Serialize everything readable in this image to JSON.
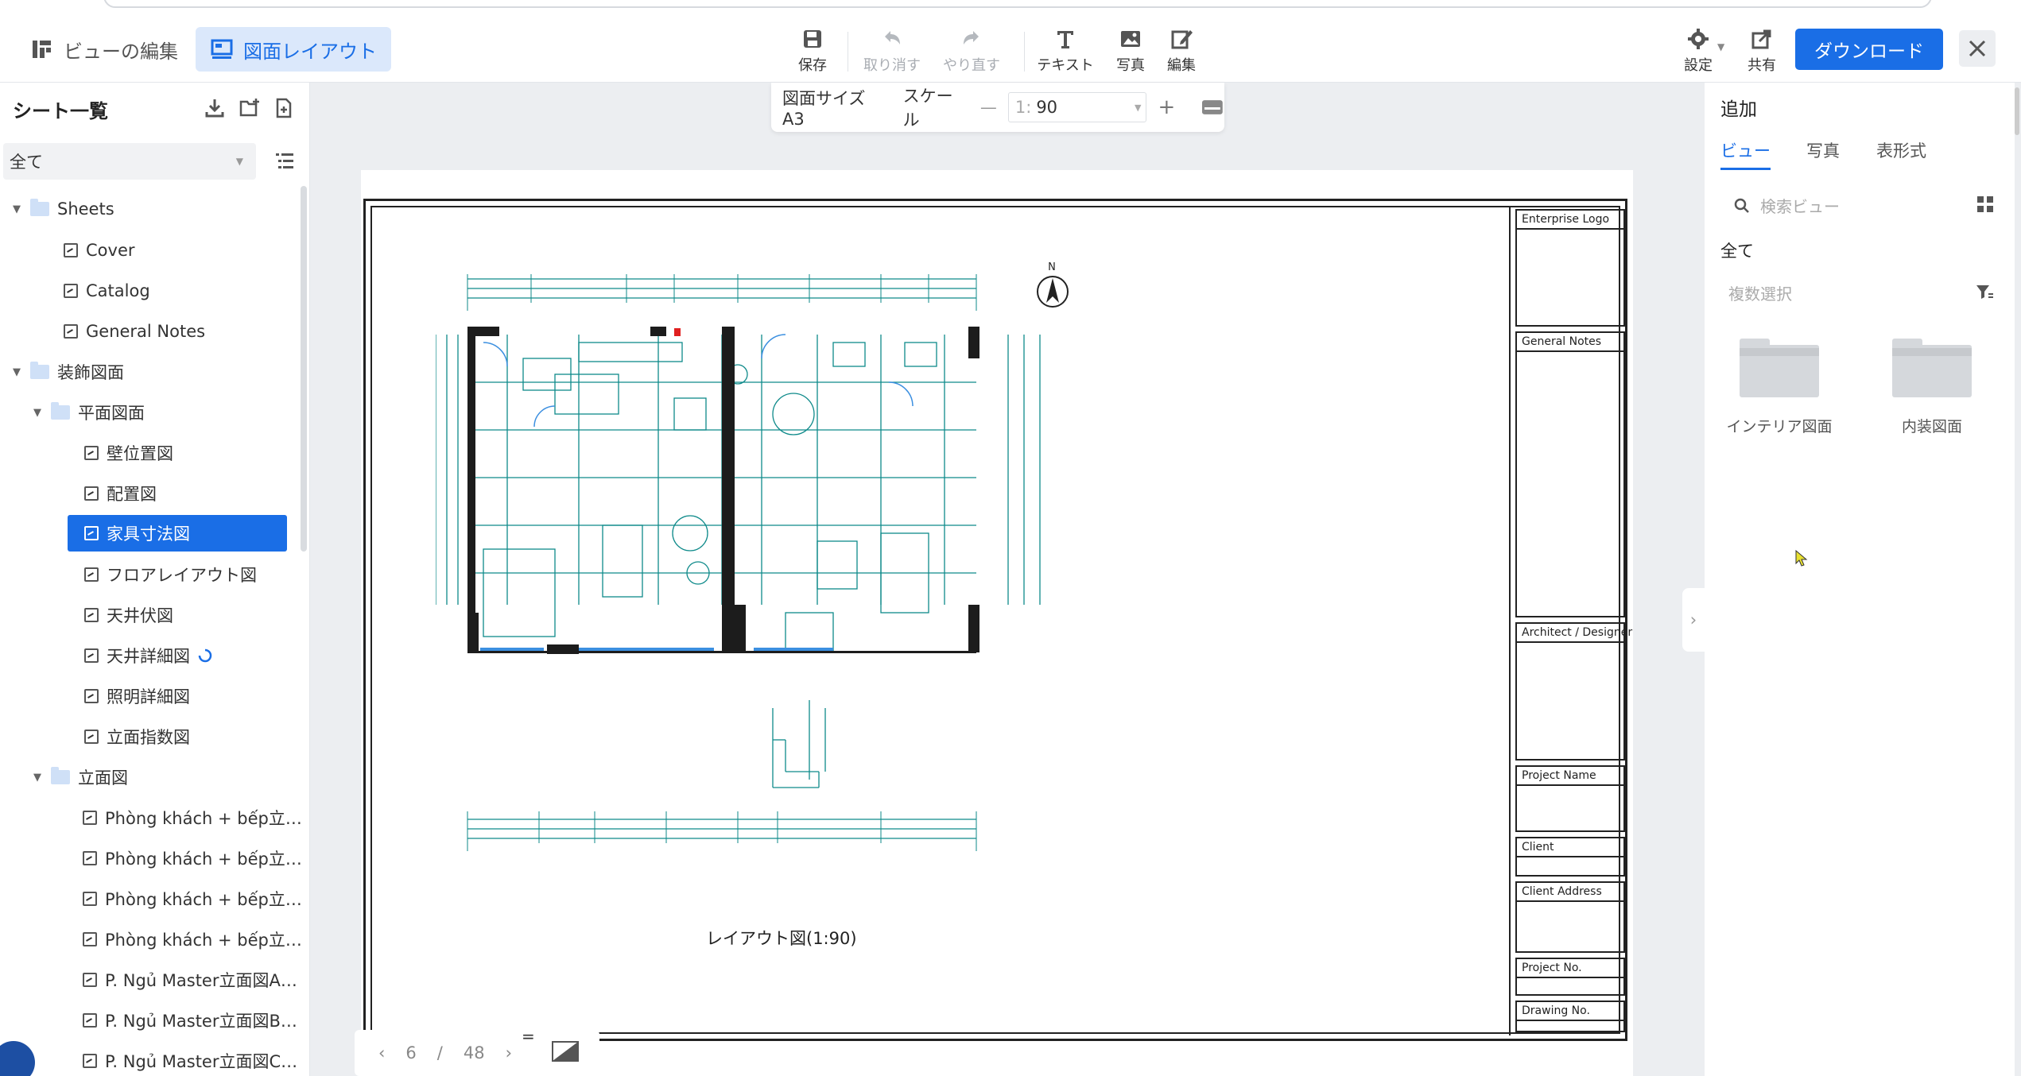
{
  "topbar": {
    "edit_view_label": "ビューの編集",
    "layout_label": "図面レイアウト",
    "tools": [
      {
        "label": "保存",
        "icon": "save-icon",
        "enabled": true
      },
      {
        "label": "取り消す",
        "icon": "undo-icon",
        "enabled": false
      },
      {
        "label": "やり直す",
        "icon": "redo-icon",
        "enabled": false
      },
      {
        "label": "テキスト",
        "icon": "text-icon",
        "enabled": true
      },
      {
        "label": "写真",
        "icon": "image-icon",
        "enabled": true
      },
      {
        "label": "編集",
        "icon": "edit-icon",
        "enabled": true
      }
    ],
    "settings_label": "設定",
    "share_label": "共有",
    "download_label": "ダウンロード",
    "accent_color": "#1a6ee6"
  },
  "sidebar": {
    "title": "シート一覧",
    "filter_value": "全て",
    "tree": [
      {
        "label": "Sheets",
        "type": "folder",
        "expanded": true
      },
      {
        "label": "Cover",
        "type": "sheet"
      },
      {
        "label": "Catalog",
        "type": "sheet"
      },
      {
        "label": "General Notes",
        "type": "sheet"
      },
      {
        "label": "装飾図面",
        "type": "folder",
        "expanded": true
      },
      {
        "label": "平面図面",
        "type": "folder",
        "expanded": true
      },
      {
        "label": "壁位置図",
        "type": "sheet"
      },
      {
        "label": "配置図",
        "type": "sheet"
      },
      {
        "label": "家具寸法図",
        "type": "sheet",
        "selected": true
      },
      {
        "label": "フロアレイアウト図",
        "type": "sheet"
      },
      {
        "label": "天井伏図",
        "type": "sheet"
      },
      {
        "label": "天井詳細図",
        "type": "sheet",
        "loading": true
      },
      {
        "label": "照明詳細図",
        "type": "sheet"
      },
      {
        "label": "立面指数図",
        "type": "sheet"
      },
      {
        "label": "立面図",
        "type": "folder",
        "expanded": true
      },
      {
        "label": "Phòng khách + bếp立…",
        "type": "sheet"
      },
      {
        "label": "Phòng khách + bếp立…",
        "type": "sheet"
      },
      {
        "label": "Phòng khách + bếp立…",
        "type": "sheet"
      },
      {
        "label": "Phòng khách + bếp立…",
        "type": "sheet"
      },
      {
        "label": "P. Ngủ Master立面図A…",
        "type": "sheet"
      },
      {
        "label": "P. Ngủ Master立面図B…",
        "type": "sheet"
      },
      {
        "label": "P. Ngủ Master立面図C…",
        "type": "sheet"
      }
    ]
  },
  "scale_bar": {
    "size_label": "図面サイズ A3",
    "scale_label": "スケール",
    "ratio_prefix": "1:",
    "ratio_value": "90"
  },
  "drawing": {
    "caption": "レイアウト図(1:90)",
    "north_label": "N",
    "title_blocks": [
      "Enterprise Logo",
      "General Notes",
      "Architect / Designer",
      "Project Name",
      "Client",
      "Client Address",
      "Project No.",
      "Drawing No."
    ],
    "plan_color": "#0e8a8a"
  },
  "pagination": {
    "current": "6",
    "separator": "/",
    "total": "48"
  },
  "right_panel": {
    "title": "追加",
    "tabs": [
      "ビュー",
      "写真",
      "表形式"
    ],
    "search_placeholder": "検索ビュー",
    "section": "全て",
    "multi_select": "複数選択",
    "cards": [
      "インテリア図面",
      "内装図面"
    ]
  }
}
